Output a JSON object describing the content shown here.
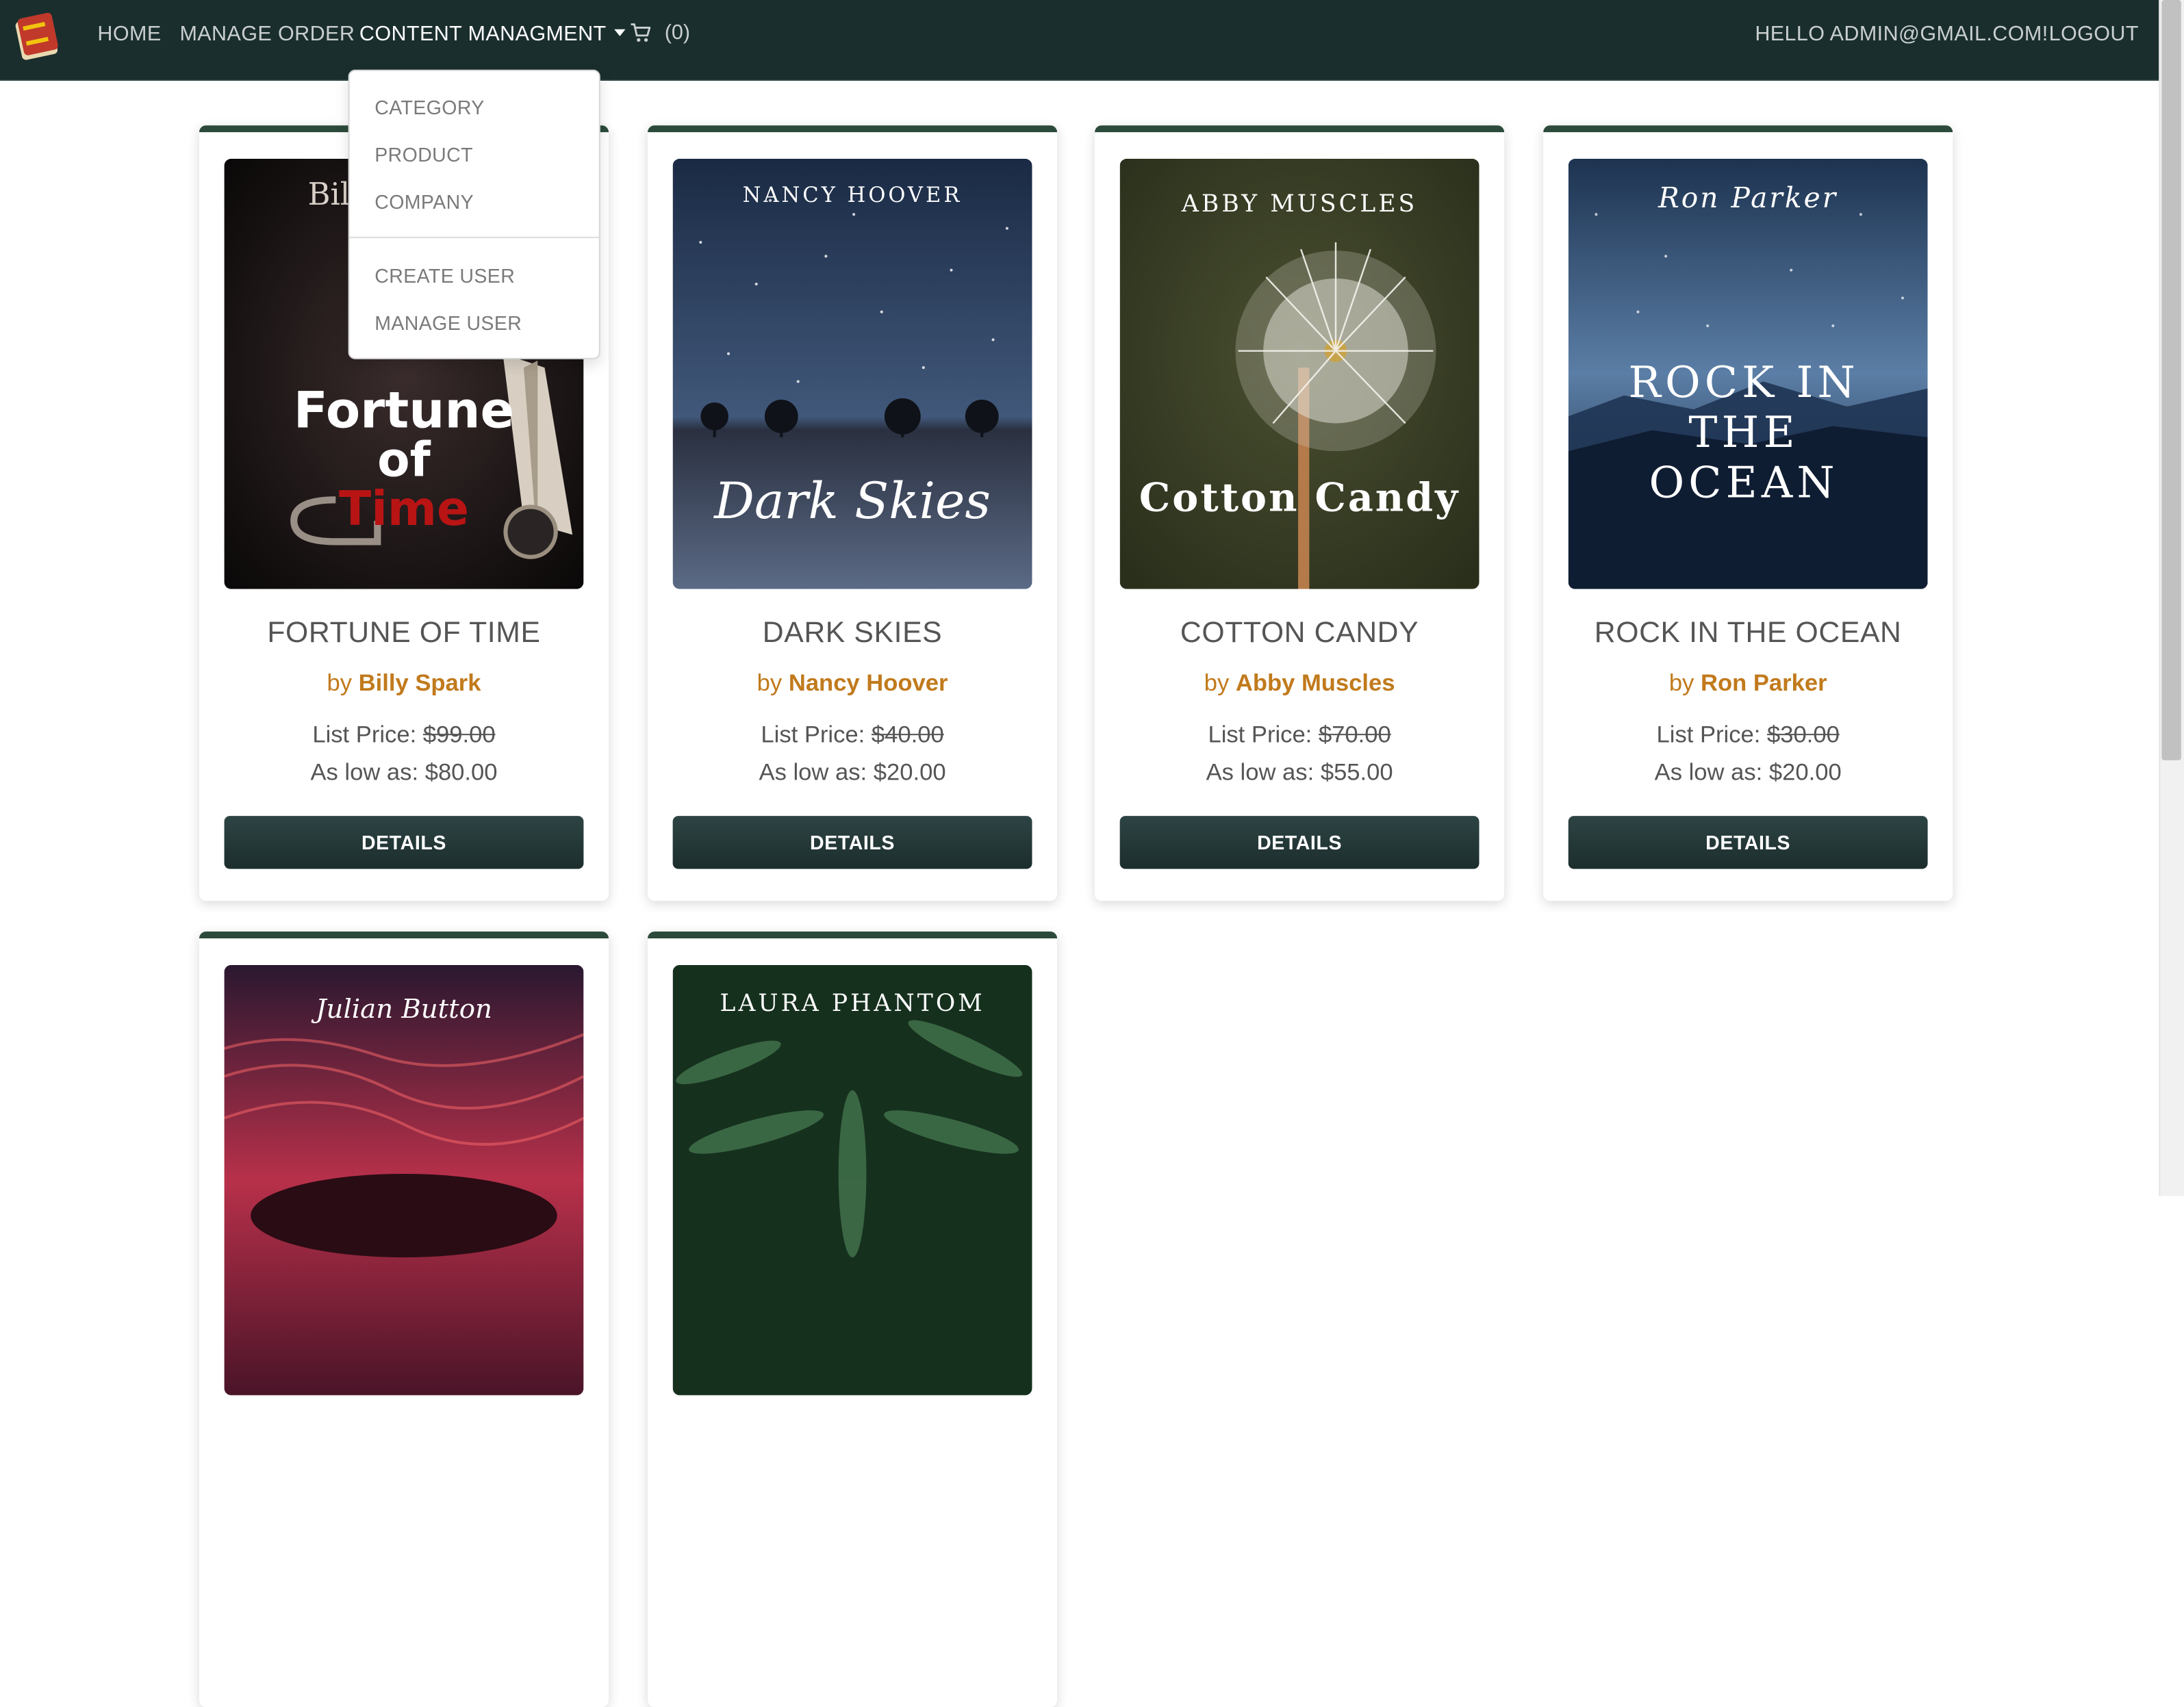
{
  "nav": {
    "home": "HOME",
    "manage_order": "MANAGE ORDER",
    "content_management": "CONTENT MANAGMENT",
    "cart_count": "(0)",
    "greeting": "HELLO ADMIN@GMAIL.COM!",
    "logout": "LOGOUT"
  },
  "dropdown": {
    "items": [
      "CATEGORY",
      "PRODUCT",
      "COMPANY",
      "CREATE USER",
      "MANAGE USER"
    ]
  },
  "books": [
    {
      "cover_author": "Billy Spark",
      "cover_title_1": "Fortune",
      "cover_title_2": "of",
      "cover_title_3": "Time",
      "title": "FORTUNE OF TIME",
      "by": "by",
      "author": "Billy Spark",
      "list_label": "List Price:",
      "list_price": "$99.00",
      "low_label": "As low as:",
      "low_price": "$80.00",
      "button": "DETAILS"
    },
    {
      "cover_author": "NANCY HOOVER",
      "cover_title_1": "Dark Skies",
      "title": "DARK SKIES",
      "by": "by",
      "author": "Nancy Hoover",
      "list_label": "List Price:",
      "list_price": "$40.00",
      "low_label": "As low as:",
      "low_price": "$20.00",
      "button": "DETAILS"
    },
    {
      "cover_author": "ABBY MUSCLES",
      "cover_title_1": "Cotton Candy",
      "title": "COTTON CANDY",
      "by": "by",
      "author": "Abby Muscles",
      "list_label": "List Price:",
      "list_price": "$70.00",
      "low_label": "As low as:",
      "low_price": "$55.00",
      "button": "DETAILS"
    },
    {
      "cover_author": "Ron Parker",
      "cover_title_1": "ROCK IN",
      "cover_title_2": "THE",
      "cover_title_3": "OCEAN",
      "title": "ROCK IN THE OCEAN",
      "by": "by",
      "author": "Ron Parker",
      "list_label": "List Price:",
      "list_price": "$30.00",
      "low_label": "As low as:",
      "low_price": "$20.00",
      "button": "DETAILS"
    },
    {
      "cover_author": "Julian Button"
    },
    {
      "cover_author": "LAURA PHANTOM"
    }
  ],
  "colors": {
    "navbar": "#1b2e2e",
    "accent": "#c17a1c",
    "card_top": "#2b4a3a"
  }
}
